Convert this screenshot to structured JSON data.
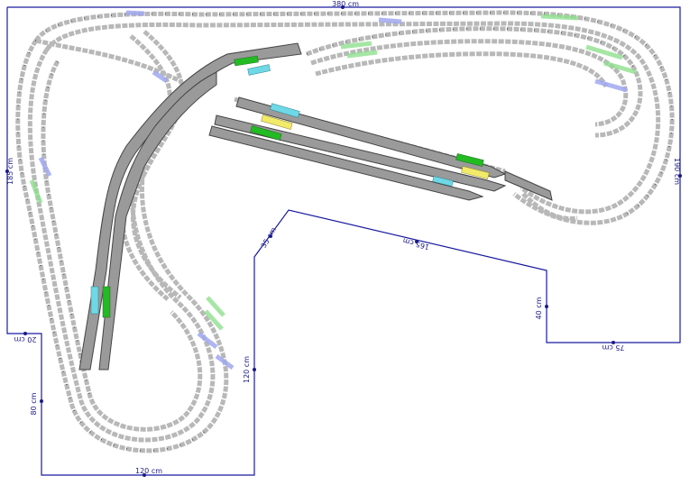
{
  "dimensions": {
    "top": "380 cm",
    "left_outer": "185 cm",
    "right_outer": "190 cm",
    "left_step": "20 cm",
    "left_inner": "80 cm",
    "bottom_left": "120 cm",
    "middle_vertical": "120 cm",
    "diag_short": "35 cm",
    "middle_horizontal": "165 cm",
    "right_inner": "40 cm",
    "bottom_right": "75 cm"
  },
  "colors": {
    "outline": "#1a1aa0",
    "track": "#b8b8b8",
    "platform": "#9a9a9a",
    "green_marker": "#22bb22",
    "cyan_marker": "#6fd8e6",
    "yellow_marker": "#f2ea6a"
  }
}
